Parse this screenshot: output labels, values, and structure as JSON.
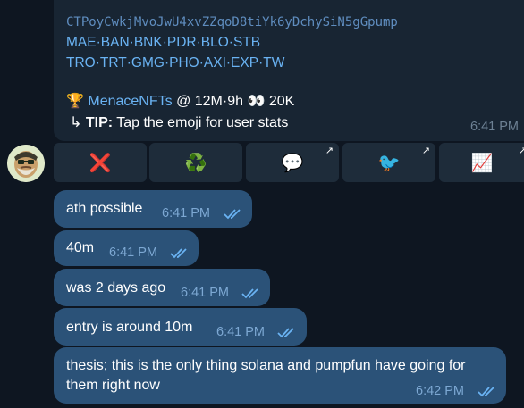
{
  "bot_message": {
    "contract_address": "CTPoyCwkjMvoJwU4xvZZqoD8tiYk6yDchySiN5gGpump",
    "links_row1": [
      "MAE",
      "BAN",
      "BNK",
      "PDR",
      "BLO",
      "STB"
    ],
    "links_row2": [
      "TRO",
      "TRT",
      "GMG",
      "PHO",
      "AXI",
      "EXP",
      "TW"
    ],
    "trophy_emoji": "🏆",
    "caller_name": "MenaceNFTs",
    "stat_prefix": " @ 12M·9h ",
    "eyes_emoji": "👀",
    "stat_suffix": " 20K",
    "tip_arrow": "↳",
    "tip_label": "TIP:",
    "tip_text": " Tap the emoji for user stats",
    "time": "6:41 PM"
  },
  "keyboard": [
    {
      "icon": "cross-mark-icon",
      "glyph": "❌",
      "has_arrow": false
    },
    {
      "icon": "recycle-icon",
      "glyph": "♻️",
      "has_arrow": false
    },
    {
      "icon": "speech-bubble-icon",
      "glyph": "💬",
      "has_arrow": true
    },
    {
      "icon": "pigeon-icon",
      "glyph": "🐦",
      "has_arrow": true
    },
    {
      "icon": "chart-increasing-icon",
      "glyph": "📈",
      "has_arrow": true
    }
  ],
  "messages": [
    {
      "text": "ath possible",
      "time": "6:41 PM"
    },
    {
      "text": "40m",
      "time": "6:41 PM"
    },
    {
      "text": "was 2 days ago",
      "time": "6:41 PM"
    },
    {
      "text": "entry is around 10m",
      "time": "6:41 PM"
    },
    {
      "text": "thesis; this is the only thing solana and pumpfun have going for them right now",
      "time": "6:42 PM"
    }
  ],
  "colors": {
    "background": "#0e1621",
    "incoming_bubble": "#182533",
    "outgoing_bubble": "#2b5278",
    "link": "#6ab3f3",
    "ticks": "#6ab3f3"
  }
}
